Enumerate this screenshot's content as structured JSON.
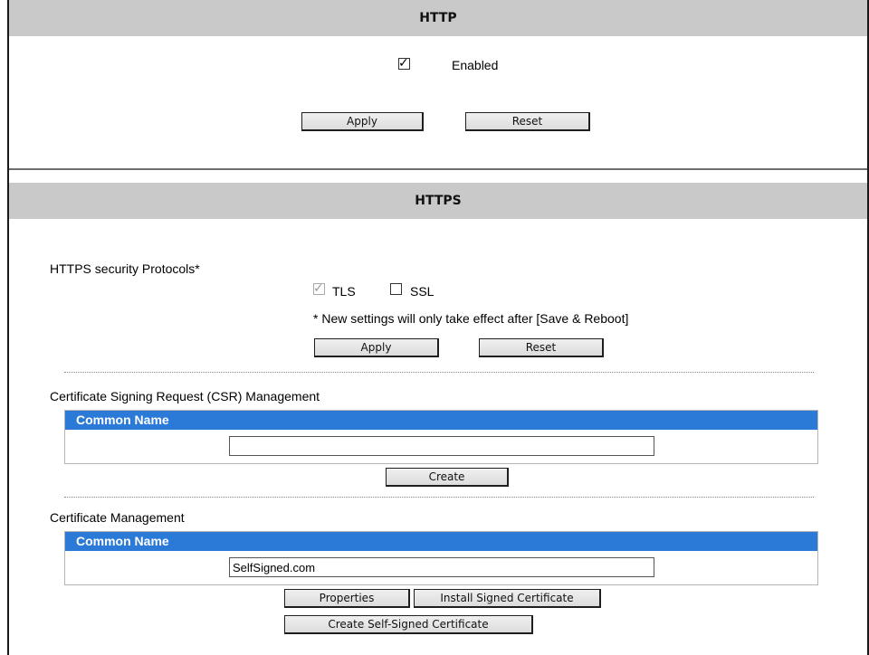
{
  "http": {
    "title": "HTTP",
    "enabled_label": "Enabled",
    "enabled_checked": true,
    "apply_label": "Apply",
    "reset_label": "Reset"
  },
  "https": {
    "title": "HTTPS",
    "protocols_label": "HTTPS security Protocols*",
    "tls_label": "TLS",
    "tls_checked": true,
    "ssl_label": "SSL",
    "ssl_checked": false,
    "note": "* New settings will only take effect after [Save & Reboot]",
    "apply_label": "Apply",
    "reset_label": "Reset"
  },
  "csr": {
    "heading": "Certificate Signing Request (CSR) Management",
    "column_header": "Common Name",
    "common_name_value": "",
    "create_label": "Create"
  },
  "cert": {
    "heading": "Certificate Management",
    "column_header": "Common Name",
    "common_name_value": "SelfSigned.com",
    "properties_label": "Properties",
    "install_label": "Install Signed Certificate",
    "create_self_signed_label": "Create Self-Signed Certificate"
  },
  "colors": {
    "header_bg": "#c9c9c9",
    "table_header_bg": "#2b7ad8"
  }
}
